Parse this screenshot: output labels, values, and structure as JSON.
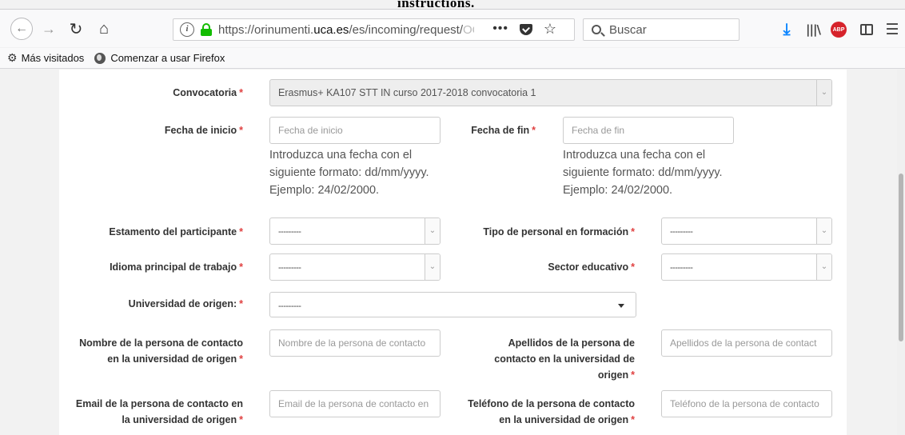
{
  "browser": {
    "tab_strip_text": "instructions.",
    "url_prefix": "https://orinumenti.",
    "url_domain": "uca.es",
    "url_path": "/es/incoming/request/",
    "url_tail": "OQ",
    "search_placeholder": "Buscar",
    "abp_label": "ABP",
    "bookmarks": [
      {
        "label": "Más visitados"
      },
      {
        "label": "Comenzar a usar Firefox"
      }
    ]
  },
  "form": {
    "convocatoria_label": "Convocatoria",
    "convocatoria_value": "Erasmus+ KA107 STT IN curso 2017-2018 convocatoria 1",
    "fecha_inicio_label": "Fecha de inicio",
    "fecha_inicio_placeholder": "Fecha de inicio",
    "fecha_fin_label": "Fecha de fin",
    "fecha_fin_placeholder": "Fecha de fin",
    "date_help_1": "Introduzca una fecha con el siguiente formato: dd/mm/yyyy. Ejemplo: 24/02/2000.",
    "date_help_2": "Introduzca una fecha con el siguiente formato: dd/mm/yyyy. Ejemplo: 24/02/2000.",
    "estamento_label": "Estamento del participante",
    "estamento_value": "---------",
    "tipo_personal_label": "Tipo de personal en formación",
    "tipo_personal_value": "---------",
    "idioma_label": "Idioma principal de trabajo",
    "idioma_value": "---------",
    "sector_label": "Sector educativo",
    "sector_value": "---------",
    "universidad_label": "Universidad de origen:",
    "universidad_value": "---------",
    "nombre_contacto_label": "Nombre de la persona de contacto en la universidad de origen",
    "nombre_contacto_placeholder": "Nombre de la persona de contacto",
    "apellidos_contacto_label": "Apellidos de la persona de contacto en la universidad de origen",
    "apellidos_contacto_placeholder": "Apellidos de la persona de contact",
    "email_contacto_label": "Email de la persona de contacto en la universidad de origen",
    "email_contacto_placeholder": "Email de la persona de contacto en",
    "telefono_contacto_label": "Teléfono de la persona de contacto en la universidad de origen",
    "telefono_contacto_placeholder": "Teléfono de la persona de contacto",
    "required_mark": "*"
  },
  "colors": {
    "accent_download": "#0a84ff",
    "required": "#e04040",
    "lock": "#12bc00",
    "abp": "#d6232b"
  }
}
